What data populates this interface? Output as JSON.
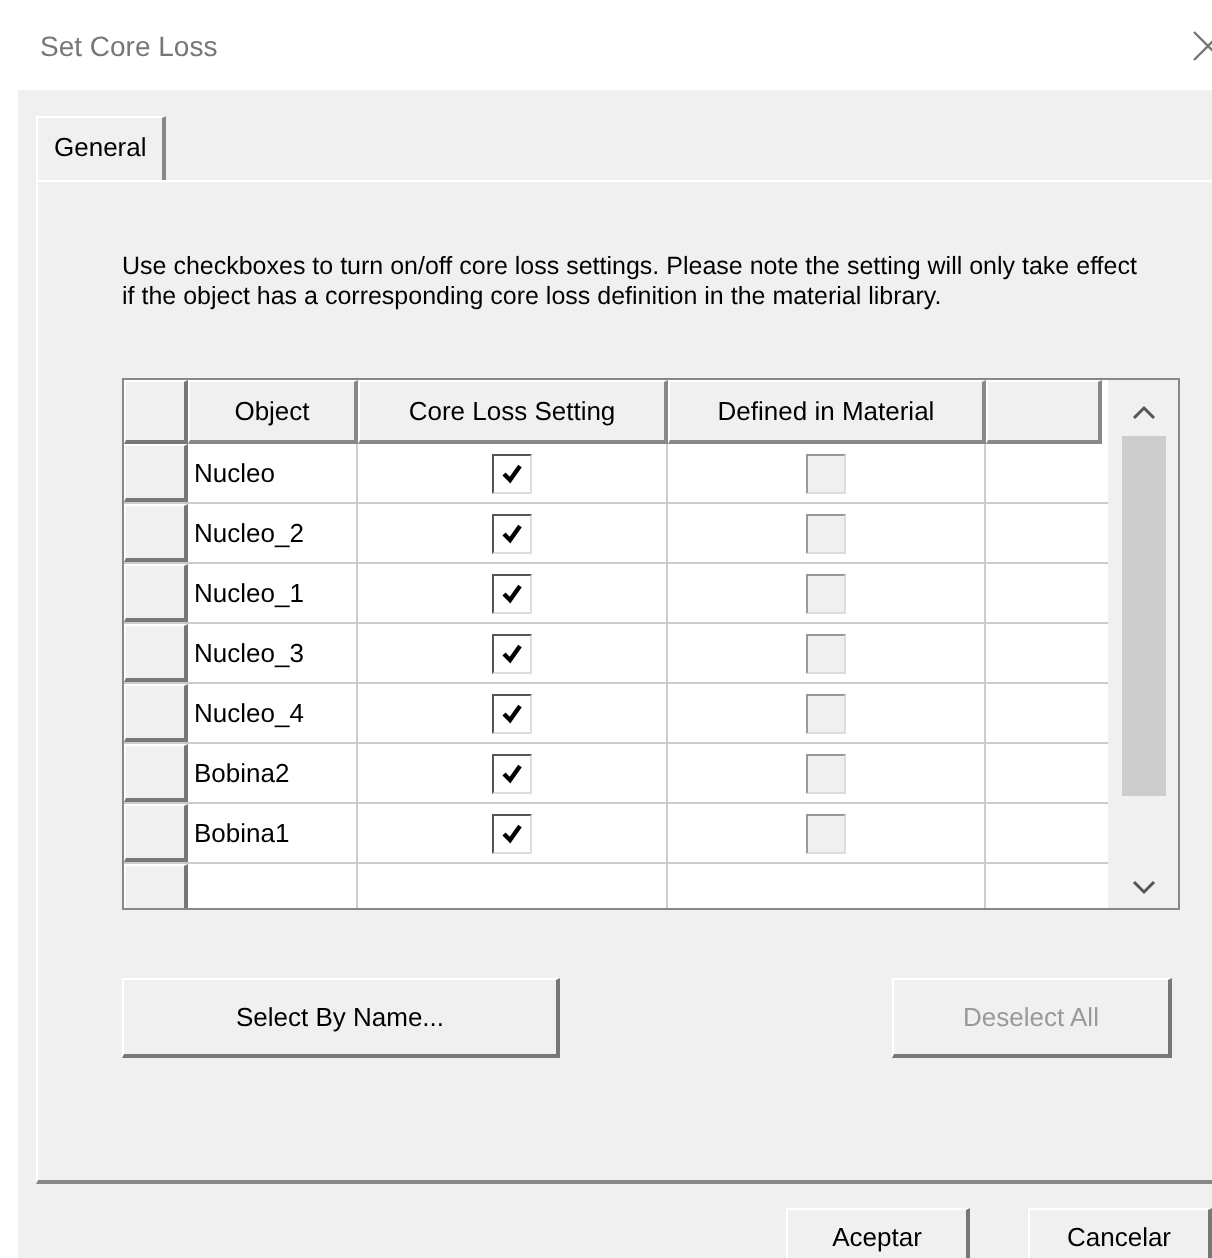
{
  "window": {
    "title": "Set Core Loss"
  },
  "tabs": [
    {
      "label": "General",
      "selected": true
    }
  ],
  "description": "Use checkboxes to turn on/off core loss settings.  Please note the setting will only take effect if the object has a corresponding core loss definition in the material library.",
  "table": {
    "columns": [
      "Object",
      "Core Loss Setting",
      "Defined in Material"
    ],
    "rows": [
      {
        "object": "Nucleo",
        "core_loss": {
          "checked": true,
          "disabled": false
        },
        "defined": {
          "checked": false,
          "disabled": true
        }
      },
      {
        "object": "Nucleo_2",
        "core_loss": {
          "checked": true,
          "disabled": false
        },
        "defined": {
          "checked": false,
          "disabled": true
        }
      },
      {
        "object": "Nucleo_1",
        "core_loss": {
          "checked": true,
          "disabled": false
        },
        "defined": {
          "checked": false,
          "disabled": true
        }
      },
      {
        "object": "Nucleo_3",
        "core_loss": {
          "checked": true,
          "disabled": false
        },
        "defined": {
          "checked": false,
          "disabled": true
        }
      },
      {
        "object": "Nucleo_4",
        "core_loss": {
          "checked": true,
          "disabled": false
        },
        "defined": {
          "checked": false,
          "disabled": true
        }
      },
      {
        "object": "Bobina2",
        "core_loss": {
          "checked": true,
          "disabled": false
        },
        "defined": {
          "checked": false,
          "disabled": true
        }
      },
      {
        "object": "Bobina1",
        "core_loss": {
          "checked": true,
          "disabled": false
        },
        "defined": {
          "checked": false,
          "disabled": true
        }
      }
    ]
  },
  "panel_buttons": [
    {
      "label": "Select By Name...",
      "disabled": false
    },
    {
      "label": "Deselect All",
      "disabled": true
    }
  ],
  "dialog_buttons": [
    {
      "label": "Aceptar",
      "disabled": false
    },
    {
      "label": "Cancelar",
      "disabled": false
    }
  ]
}
